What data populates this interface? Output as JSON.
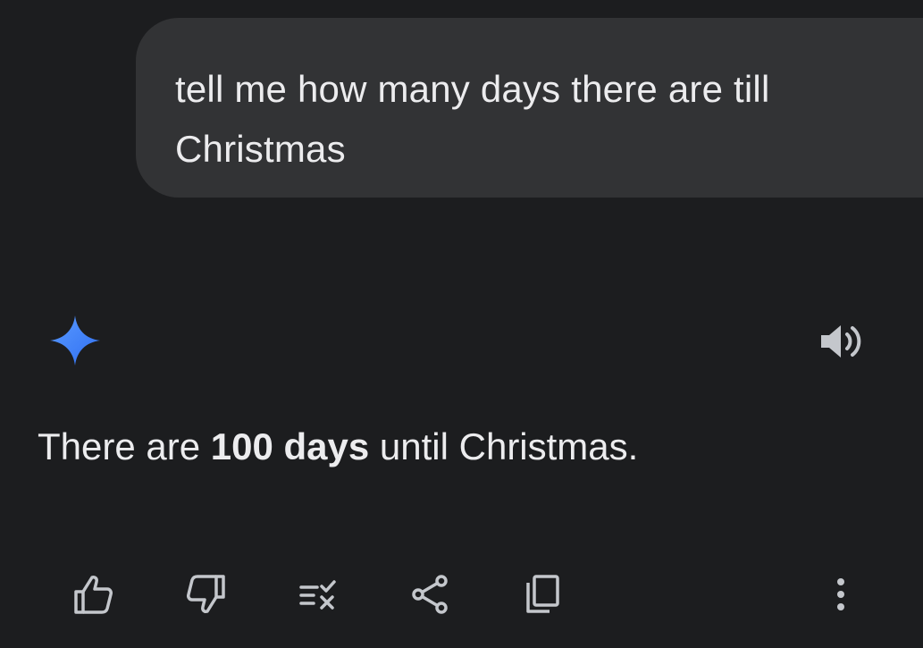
{
  "user_message": {
    "text": "tell me how many days there are till Christmas"
  },
  "response": {
    "prefix": "There are ",
    "bold": "100 days",
    "suffix": " until Christmas."
  },
  "icons": {
    "assistant": "sparkle-icon",
    "speaker": "speaker-icon",
    "actions": [
      "thumbs-up-icon",
      "thumbs-down-icon",
      "modify-response-icon",
      "share-icon",
      "copy-icon",
      "more-vert-icon"
    ]
  },
  "colors": {
    "background": "#1c1d1f",
    "user_bubble": "#323335",
    "text": "#ececee",
    "icon": "#c4c7cc",
    "sparkle": "#4a86ff"
  }
}
